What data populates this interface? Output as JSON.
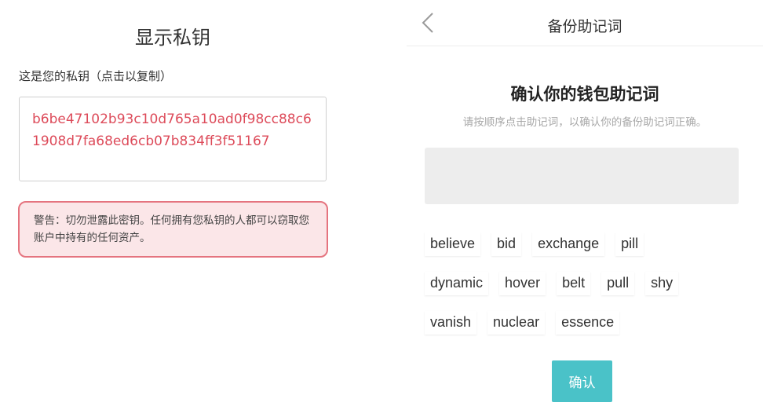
{
  "left": {
    "title": "显示私钥",
    "label": "这是您的私钥（点击以复制）",
    "private_key": "b6be47102b93c10d765a10ad0f98cc88c61908d7fa68ed6cb07b834ff3f51167",
    "warning": "警告：切勿泄露此密钥。任何拥有您私钥的人都可以窃取您账户中持有的任何资产。"
  },
  "right": {
    "nav_title": "备份助记词",
    "back_icon": "chevron-left-icon",
    "heading": "确认你的钱包助记词",
    "subtitle": "请按顺序点击助记词，以确认你的备份助记词正确。",
    "words": {
      "row1": [
        "believe",
        "bid",
        "exchange",
        "pill"
      ],
      "row2": [
        "dynamic",
        "hover",
        "belt",
        "pull",
        "shy"
      ],
      "row3": [
        "vanish",
        "nuclear",
        "essence"
      ]
    },
    "confirm_label": "确认"
  },
  "colors": {
    "key_text": "#dd4b5a",
    "warning_border": "#e5747f",
    "warning_bg": "#fbe6e8",
    "confirm_bg": "#4ac2c8"
  }
}
